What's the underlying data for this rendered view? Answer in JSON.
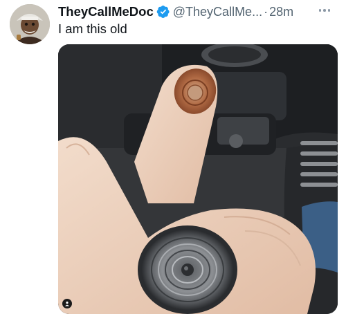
{
  "tweet": {
    "author_name": "TheyCallMeDoc",
    "handle": "@TheyCallMe...",
    "separator": "·",
    "time": "28m",
    "text": "I am this old",
    "verified": true
  },
  "icons": {
    "verified": "verified-badge-icon",
    "more": "more-options-icon",
    "media_badge": "person-icon"
  },
  "colors": {
    "verified": "#1d9bf0",
    "secondary_text": "#536471",
    "primary_text": "#0f1419"
  }
}
